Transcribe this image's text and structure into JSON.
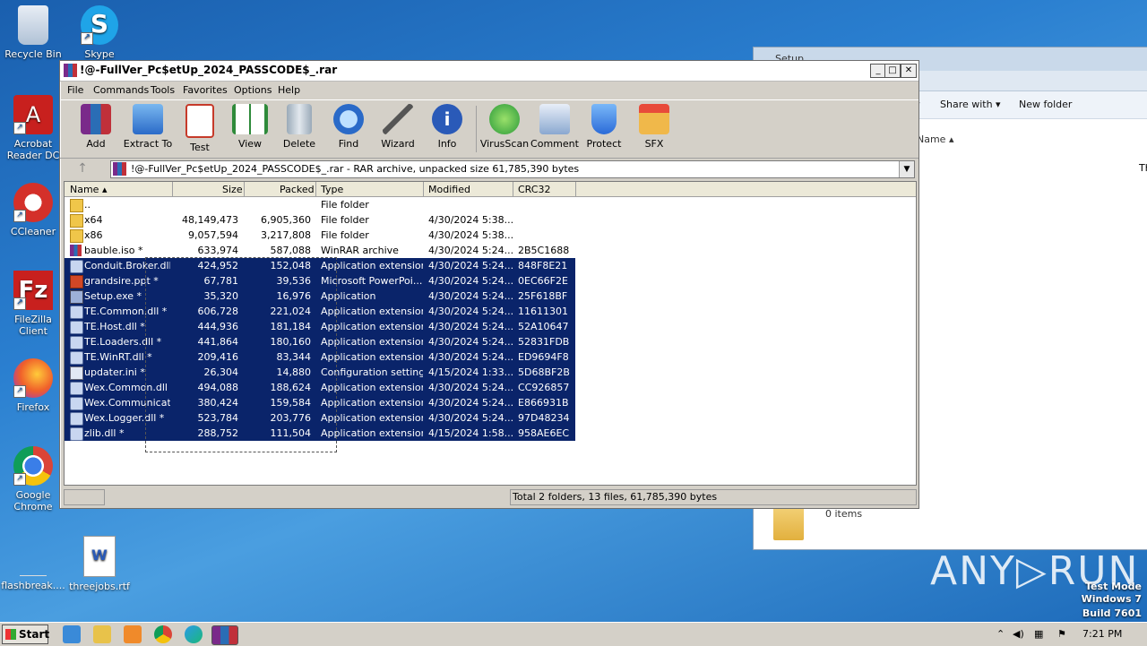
{
  "desktop": {
    "icons": [
      {
        "label": "Recycle Bin"
      },
      {
        "label": "Skype"
      },
      {
        "label": "Acrobat Reader DC"
      },
      {
        "label": "CCleaner"
      },
      {
        "label": "FileZilla Client"
      },
      {
        "label": "Firefox"
      },
      {
        "label": "Google Chrome"
      },
      {
        "label": "flashbreak...."
      },
      {
        "label": "threejobs.rtf"
      }
    ],
    "watermark": "ANY▷RUN",
    "test_mode": [
      "Test Mode",
      "Windows 7",
      "Build 7601"
    ]
  },
  "explorer": {
    "title": "Setup",
    "share_with": "Share with",
    "new_folder": "New folder",
    "col_name": "Name",
    "items": "0 items",
    "edge_text": "Th"
  },
  "winrar": {
    "title": "!@-FullVer_Pc$etUp_2024_PASSCODE$_.rar",
    "menu": [
      "File",
      "Commands",
      "Tools",
      "Favorites",
      "Options",
      "Help"
    ],
    "toolbar": [
      {
        "label": "Add",
        "icon": "add-icon",
        "color": "#b05a2a"
      },
      {
        "label": "Extract To",
        "icon": "extract-folder-icon",
        "color": "#3a8ad8"
      },
      {
        "label": "Test",
        "icon": "test-clipboard-icon",
        "color": "#c63a2a"
      },
      {
        "label": "View",
        "icon": "view-book-icon",
        "color": "#2e8a3a"
      },
      {
        "label": "Delete",
        "icon": "trash-icon",
        "color": "#8a9aa8"
      },
      {
        "label": "Find",
        "icon": "magnifier-icon",
        "color": "#2a6ac8"
      },
      {
        "label": "Wizard",
        "icon": "wand-icon",
        "color": "#7ac84a"
      },
      {
        "label": "Info",
        "icon": "info-icon",
        "color": "#2a5ab8"
      },
      {
        "label": "VirusScan",
        "icon": "virus-icon",
        "color": "#2a9a3a"
      },
      {
        "label": "Comment",
        "icon": "comment-icon",
        "color": "#6a8ab8"
      },
      {
        "label": "Protect",
        "icon": "shield-icon",
        "color": "#2a6ad8"
      },
      {
        "label": "SFX",
        "icon": "sfx-box-icon",
        "color": "#d88a2a"
      }
    ],
    "path": "!@-FullVer_Pc$etUp_2024_PASSCODE$_.rar - RAR archive, unpacked size 61,785,390 bytes",
    "columns": {
      "name": "Name",
      "size": "Size",
      "packed": "Packed",
      "type": "Type",
      "modified": "Modified",
      "crc": "CRC32"
    },
    "rows": [
      {
        "name": "..",
        "size": "",
        "packed": "",
        "type": "File folder",
        "modified": "",
        "crc": "",
        "kind": "folder",
        "selected": false
      },
      {
        "name": "x64",
        "size": "48,149,473",
        "packed": "6,905,360",
        "type": "File folder",
        "modified": "4/30/2024 5:38...",
        "crc": "",
        "kind": "folder",
        "selected": false
      },
      {
        "name": "x86",
        "size": "9,057,594",
        "packed": "3,217,808",
        "type": "File folder",
        "modified": "4/30/2024 5:38...",
        "crc": "",
        "kind": "folder",
        "selected": false
      },
      {
        "name": "bauble.iso *",
        "size": "633,974",
        "packed": "587,088",
        "type": "WinRAR archive",
        "modified": "4/30/2024 5:24...",
        "crc": "2B5C1688",
        "kind": "rarf",
        "selected": false
      },
      {
        "name": "Conduit.Broker.dll *",
        "size": "424,952",
        "packed": "152,048",
        "type": "Application extension",
        "modified": "4/30/2024 5:24...",
        "crc": "848F8E21",
        "kind": "dll",
        "selected": true
      },
      {
        "name": "grandsire.ppt *",
        "size": "67,781",
        "packed": "39,536",
        "type": "Microsoft PowerPoi...",
        "modified": "4/30/2024 5:24...",
        "crc": "0EC66F2E",
        "kind": "ppt",
        "selected": true
      },
      {
        "name": "Setup.exe *",
        "size": "35,320",
        "packed": "16,976",
        "type": "Application",
        "modified": "4/30/2024 5:24...",
        "crc": "25F618BF",
        "kind": "exe",
        "selected": true
      },
      {
        "name": "TE.Common.dll *",
        "size": "606,728",
        "packed": "221,024",
        "type": "Application extension",
        "modified": "4/30/2024 5:24...",
        "crc": "11611301",
        "kind": "dll",
        "selected": true
      },
      {
        "name": "TE.Host.dll *",
        "size": "444,936",
        "packed": "181,184",
        "type": "Application extension",
        "modified": "4/30/2024 5:24...",
        "crc": "52A10647",
        "kind": "dll",
        "selected": true
      },
      {
        "name": "TE.Loaders.dll *",
        "size": "441,864",
        "packed": "180,160",
        "type": "Application extension",
        "modified": "4/30/2024 5:24...",
        "crc": "52831FDB",
        "kind": "dll",
        "selected": true
      },
      {
        "name": "TE.WinRT.dll *",
        "size": "209,416",
        "packed": "83,344",
        "type": "Application extension",
        "modified": "4/30/2024 5:24...",
        "crc": "ED9694F8",
        "kind": "dll",
        "selected": true
      },
      {
        "name": "updater.ini *",
        "size": "26,304",
        "packed": "14,880",
        "type": "Configuration settings",
        "modified": "4/15/2024 1:33...",
        "crc": "5D68BF2B",
        "kind": "ini",
        "selected": true
      },
      {
        "name": "Wex.Common.dll *",
        "size": "494,088",
        "packed": "188,624",
        "type": "Application extension",
        "modified": "4/30/2024 5:24...",
        "crc": "CC926857",
        "kind": "dll",
        "selected": true
      },
      {
        "name": "Wex.Communicat...",
        "size": "380,424",
        "packed": "159,584",
        "type": "Application extension",
        "modified": "4/30/2024 5:24...",
        "crc": "E866931B",
        "kind": "dll",
        "selected": true
      },
      {
        "name": "Wex.Logger.dll *",
        "size": "523,784",
        "packed": "203,776",
        "type": "Application extension",
        "modified": "4/30/2024 5:24...",
        "crc": "97D48234",
        "kind": "dll",
        "selected": true
      },
      {
        "name": "zlib.dll *",
        "size": "288,752",
        "packed": "111,504",
        "type": "Application extension",
        "modified": "4/15/2024 1:58...",
        "crc": "958AE6EC",
        "kind": "dll",
        "selected": true
      }
    ],
    "status": "Total 2 folders, 13 files, 61,785,390 bytes"
  },
  "taskbar": {
    "start": "Start",
    "clock": "7:21 PM"
  }
}
